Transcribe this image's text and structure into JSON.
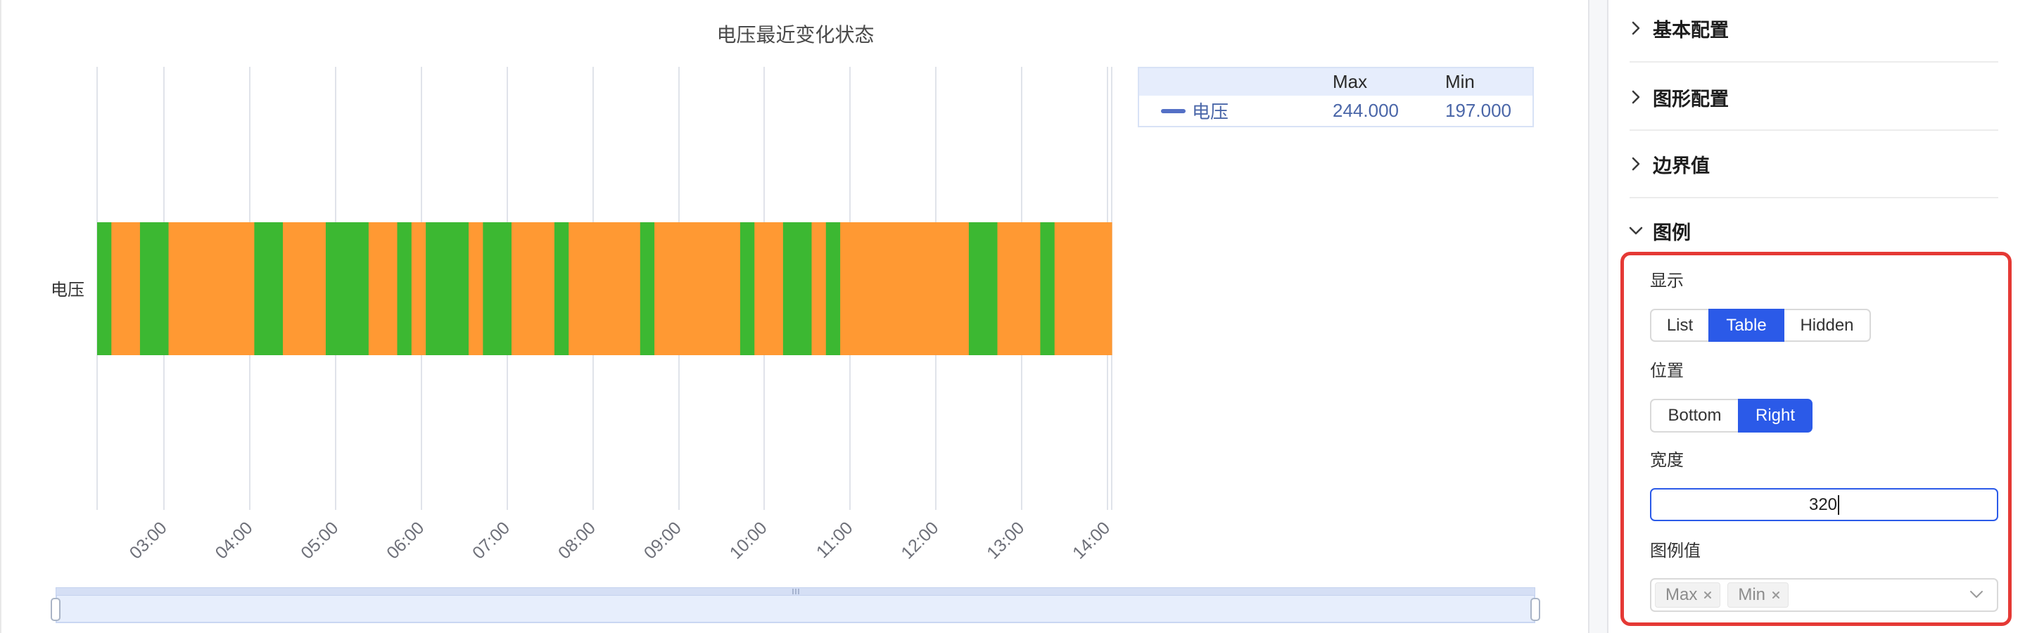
{
  "colors": {
    "accent": "#2b5ae8",
    "highlight": "#e53935"
  },
  "chart_data": {
    "type": "bar",
    "orientation": "horizontal",
    "title": "电压最近变化状态",
    "categories": [
      "电压"
    ],
    "x_range": [
      "02:13",
      "14:03"
    ],
    "x_ticks": [
      "03:00",
      "04:00",
      "05:00",
      "06:00",
      "07:00",
      "08:00",
      "09:00",
      "10:00",
      "11:00",
      "12:00",
      "13:00",
      "14:00"
    ],
    "grid": true,
    "segments": [
      {
        "start": "02:13",
        "end": "02:23",
        "color": "#3cb832"
      },
      {
        "start": "02:23",
        "end": "02:43",
        "color": "#ff9933"
      },
      {
        "start": "02:43",
        "end": "03:03",
        "color": "#3cb832"
      },
      {
        "start": "03:03",
        "end": "04:03",
        "color": "#ff9933"
      },
      {
        "start": "04:03",
        "end": "04:23",
        "color": "#3cb832"
      },
      {
        "start": "04:23",
        "end": "04:53",
        "color": "#ff9933"
      },
      {
        "start": "04:53",
        "end": "05:23",
        "color": "#3cb832"
      },
      {
        "start": "05:23",
        "end": "05:43",
        "color": "#ff9933"
      },
      {
        "start": "05:43",
        "end": "05:53",
        "color": "#3cb832"
      },
      {
        "start": "05:53",
        "end": "06:03",
        "color": "#ff9933"
      },
      {
        "start": "06:03",
        "end": "06:33",
        "color": "#3cb832"
      },
      {
        "start": "06:33",
        "end": "06:43",
        "color": "#ff9933"
      },
      {
        "start": "06:43",
        "end": "07:03",
        "color": "#3cb832"
      },
      {
        "start": "07:03",
        "end": "07:33",
        "color": "#ff9933"
      },
      {
        "start": "07:33",
        "end": "07:43",
        "color": "#3cb832"
      },
      {
        "start": "07:43",
        "end": "08:33",
        "color": "#ff9933"
      },
      {
        "start": "08:33",
        "end": "08:43",
        "color": "#3cb832"
      },
      {
        "start": "08:43",
        "end": "09:43",
        "color": "#ff9933"
      },
      {
        "start": "09:43",
        "end": "09:53",
        "color": "#3cb832"
      },
      {
        "start": "09:53",
        "end": "10:13",
        "color": "#ff9933"
      },
      {
        "start": "10:13",
        "end": "10:33",
        "color": "#3cb832"
      },
      {
        "start": "10:33",
        "end": "10:43",
        "color": "#ff9933"
      },
      {
        "start": "10:43",
        "end": "10:53",
        "color": "#3cb832"
      },
      {
        "start": "10:53",
        "end": "12:23",
        "color": "#ff9933"
      },
      {
        "start": "12:23",
        "end": "12:43",
        "color": "#3cb832"
      },
      {
        "start": "12:43",
        "end": "13:13",
        "color": "#ff9933"
      },
      {
        "start": "13:13",
        "end": "13:23",
        "color": "#3cb832"
      },
      {
        "start": "13:23",
        "end": "14:03",
        "color": "#ff9933"
      }
    ],
    "legend": {
      "placement": "right",
      "mode": "table",
      "columns": [
        "Max",
        "Min"
      ],
      "rows": [
        {
          "name": "电压",
          "max": "244.000",
          "min": "197.000",
          "color": "#5470c6"
        }
      ]
    },
    "data_zoom": {
      "start_percent": 0,
      "end_percent": 100
    }
  },
  "panel": {
    "sections": [
      {
        "label": "基本配置",
        "icon": "chevron-right-icon",
        "expanded": false
      },
      {
        "label": "图形配置",
        "icon": "chevron-right-icon",
        "expanded": false
      },
      {
        "label": "边界值",
        "icon": "chevron-right-icon",
        "expanded": false
      },
      {
        "label": "图例",
        "icon": "chevron-down-icon",
        "expanded": true
      }
    ],
    "legend_settings": {
      "display": {
        "label": "显示",
        "options": [
          "List",
          "Table",
          "Hidden"
        ],
        "selected_index": 1
      },
      "position": {
        "label": "位置",
        "options": [
          "Bottom",
          "Right"
        ],
        "selected_index": 1
      },
      "width": {
        "label": "宽度",
        "value": "320"
      },
      "values": {
        "label": "图例值",
        "tags": [
          "Max",
          "Min"
        ],
        "tag_remove_icon": "close-icon",
        "dropdown_icon": "chevron-down-icon"
      }
    }
  }
}
